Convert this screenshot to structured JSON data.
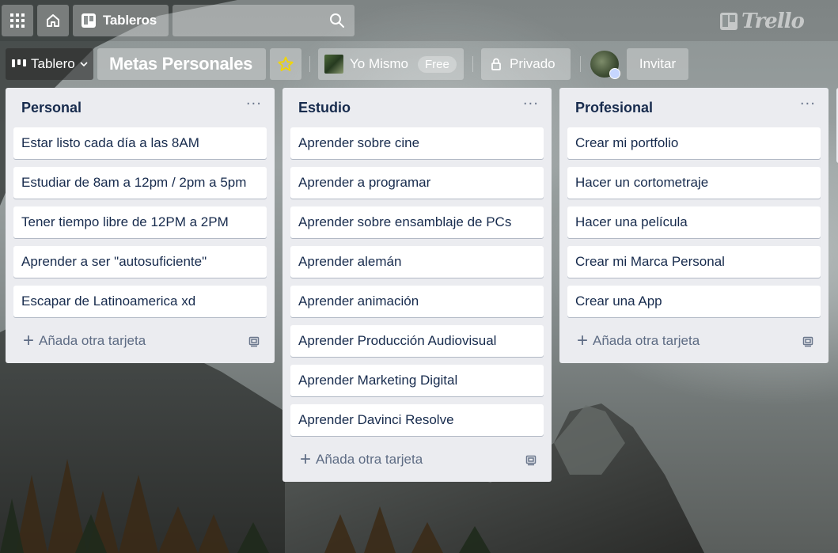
{
  "nav": {
    "apps_icon": "grid-icon",
    "home_icon": "home-icon",
    "boards_label": "Tableros",
    "search_placeholder": "",
    "logo_text": "Trello"
  },
  "board": {
    "view_label": "Tablero",
    "title": "Metas Personales",
    "team_name": "Yo Mismo",
    "team_badge": "Free",
    "visibility_label": "Privado",
    "invite_label": "Invitar",
    "accent_star": "#f2d600"
  },
  "lists": [
    {
      "title": "Personal",
      "cards": [
        "Estar listo cada día a las 8AM",
        "Estudiar de 8am a 12pm / 2pm a 5pm",
        "Tener tiempo libre de 12PM a 2PM",
        "Aprender a ser \"autosuficiente\"",
        "Escapar de Latinoamerica xd"
      ],
      "add_label": "Añada otra tarjeta"
    },
    {
      "title": "Estudio",
      "cards": [
        "Aprender sobre cine",
        "Aprender a programar",
        "Aprender sobre ensamblaje de PCs",
        "Aprender alemán",
        "Aprender animación",
        "Aprender Producción Audiovisual",
        "Aprender Marketing Digital",
        "Aprender Davinci Resolve"
      ],
      "add_label": "Añada otra tarjeta"
    },
    {
      "title": "Profesional",
      "cards": [
        "Crear mi portfolio",
        "Hacer un cortometraje",
        "Hacer una película",
        "Crear mi Marca Personal",
        "Crear una App"
      ],
      "add_label": "Añada otra tarjeta"
    }
  ]
}
